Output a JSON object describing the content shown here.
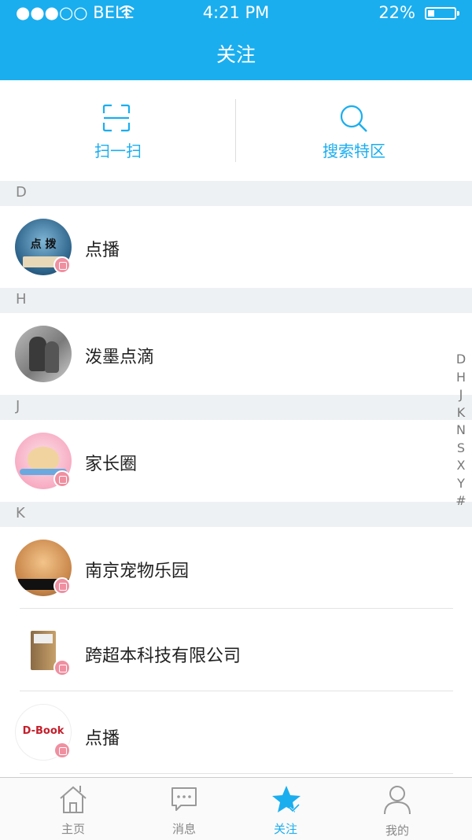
{
  "status": {
    "carrier": "●●●○○ BELL",
    "time": "4:21 PM",
    "battery": "22%"
  },
  "header": {
    "title": "关注"
  },
  "actions": {
    "scan_label": "扫一扫",
    "search_label": "搜索特区"
  },
  "sections": [
    "D",
    "H",
    "J",
    "K"
  ],
  "rows": [
    "点播",
    "泼墨点滴",
    "家长圈",
    "南京宠物乐园",
    "跨超本科技有限公司",
    "点播"
  ],
  "avatar_texts": {
    "dianbo": "点 拨",
    "dbook": "D-Book"
  },
  "index": [
    "D",
    "H",
    "J",
    "K",
    "N",
    "S",
    "X",
    "Y",
    "#"
  ],
  "tabs": [
    "主页",
    "消息",
    "关注",
    "我的"
  ],
  "colors": {
    "accent": "#1aaeef",
    "badge": "#f08fa0",
    "section_bg": "#eef1f3"
  }
}
